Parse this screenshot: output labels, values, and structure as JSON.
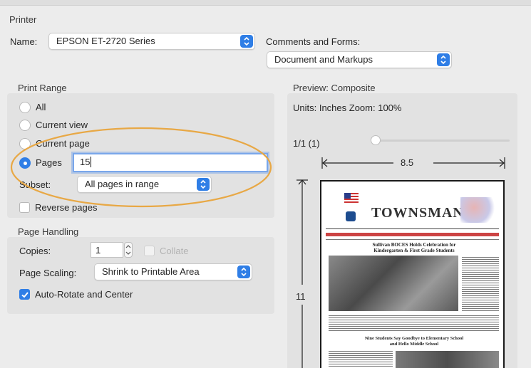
{
  "printer": {
    "section_title": "Printer",
    "name_label": "Name:",
    "name_value": "EPSON ET-2720 Series",
    "comments_label": "Comments and Forms:",
    "comments_value": "Document and Markups"
  },
  "print_range": {
    "section_title": "Print Range",
    "options": [
      "All",
      "Current view",
      "Current page",
      "Pages"
    ],
    "selected": "Pages",
    "pages_value": "15",
    "subset_label": "Subset:",
    "subset_value": "All pages in range",
    "reverse_label": "Reverse pages",
    "reverse_checked": false
  },
  "page_handling": {
    "section_title": "Page Handling",
    "copies_label": "Copies:",
    "copies_value": "1",
    "collate_label": "Collate",
    "collate_checked": false,
    "scaling_label": "Page Scaling:",
    "scaling_value": "Shrink to Printable Area",
    "autorotate_label": "Auto-Rotate and Center",
    "autorotate_checked": true
  },
  "preview": {
    "section_title": "Preview: Composite",
    "units_zoom": "Units: Inches Zoom: 100%",
    "page_indicator": "1/1 (1)",
    "width_dim": "8.5",
    "height_dim": "11",
    "slider_value": 0
  },
  "newspaper": {
    "masthead": "TOWNSMAN",
    "headline1": "Sullivan BOCES Holds Celebration for",
    "headline1b": "Kindergarten & First Grade Students",
    "headline2": "Nine Students Say Goodbye to Elementary School",
    "headline2b": "and Hello Middle School"
  },
  "colors": {
    "accent": "#2f7ee6",
    "annotation_ellipse": "#e8a845"
  }
}
